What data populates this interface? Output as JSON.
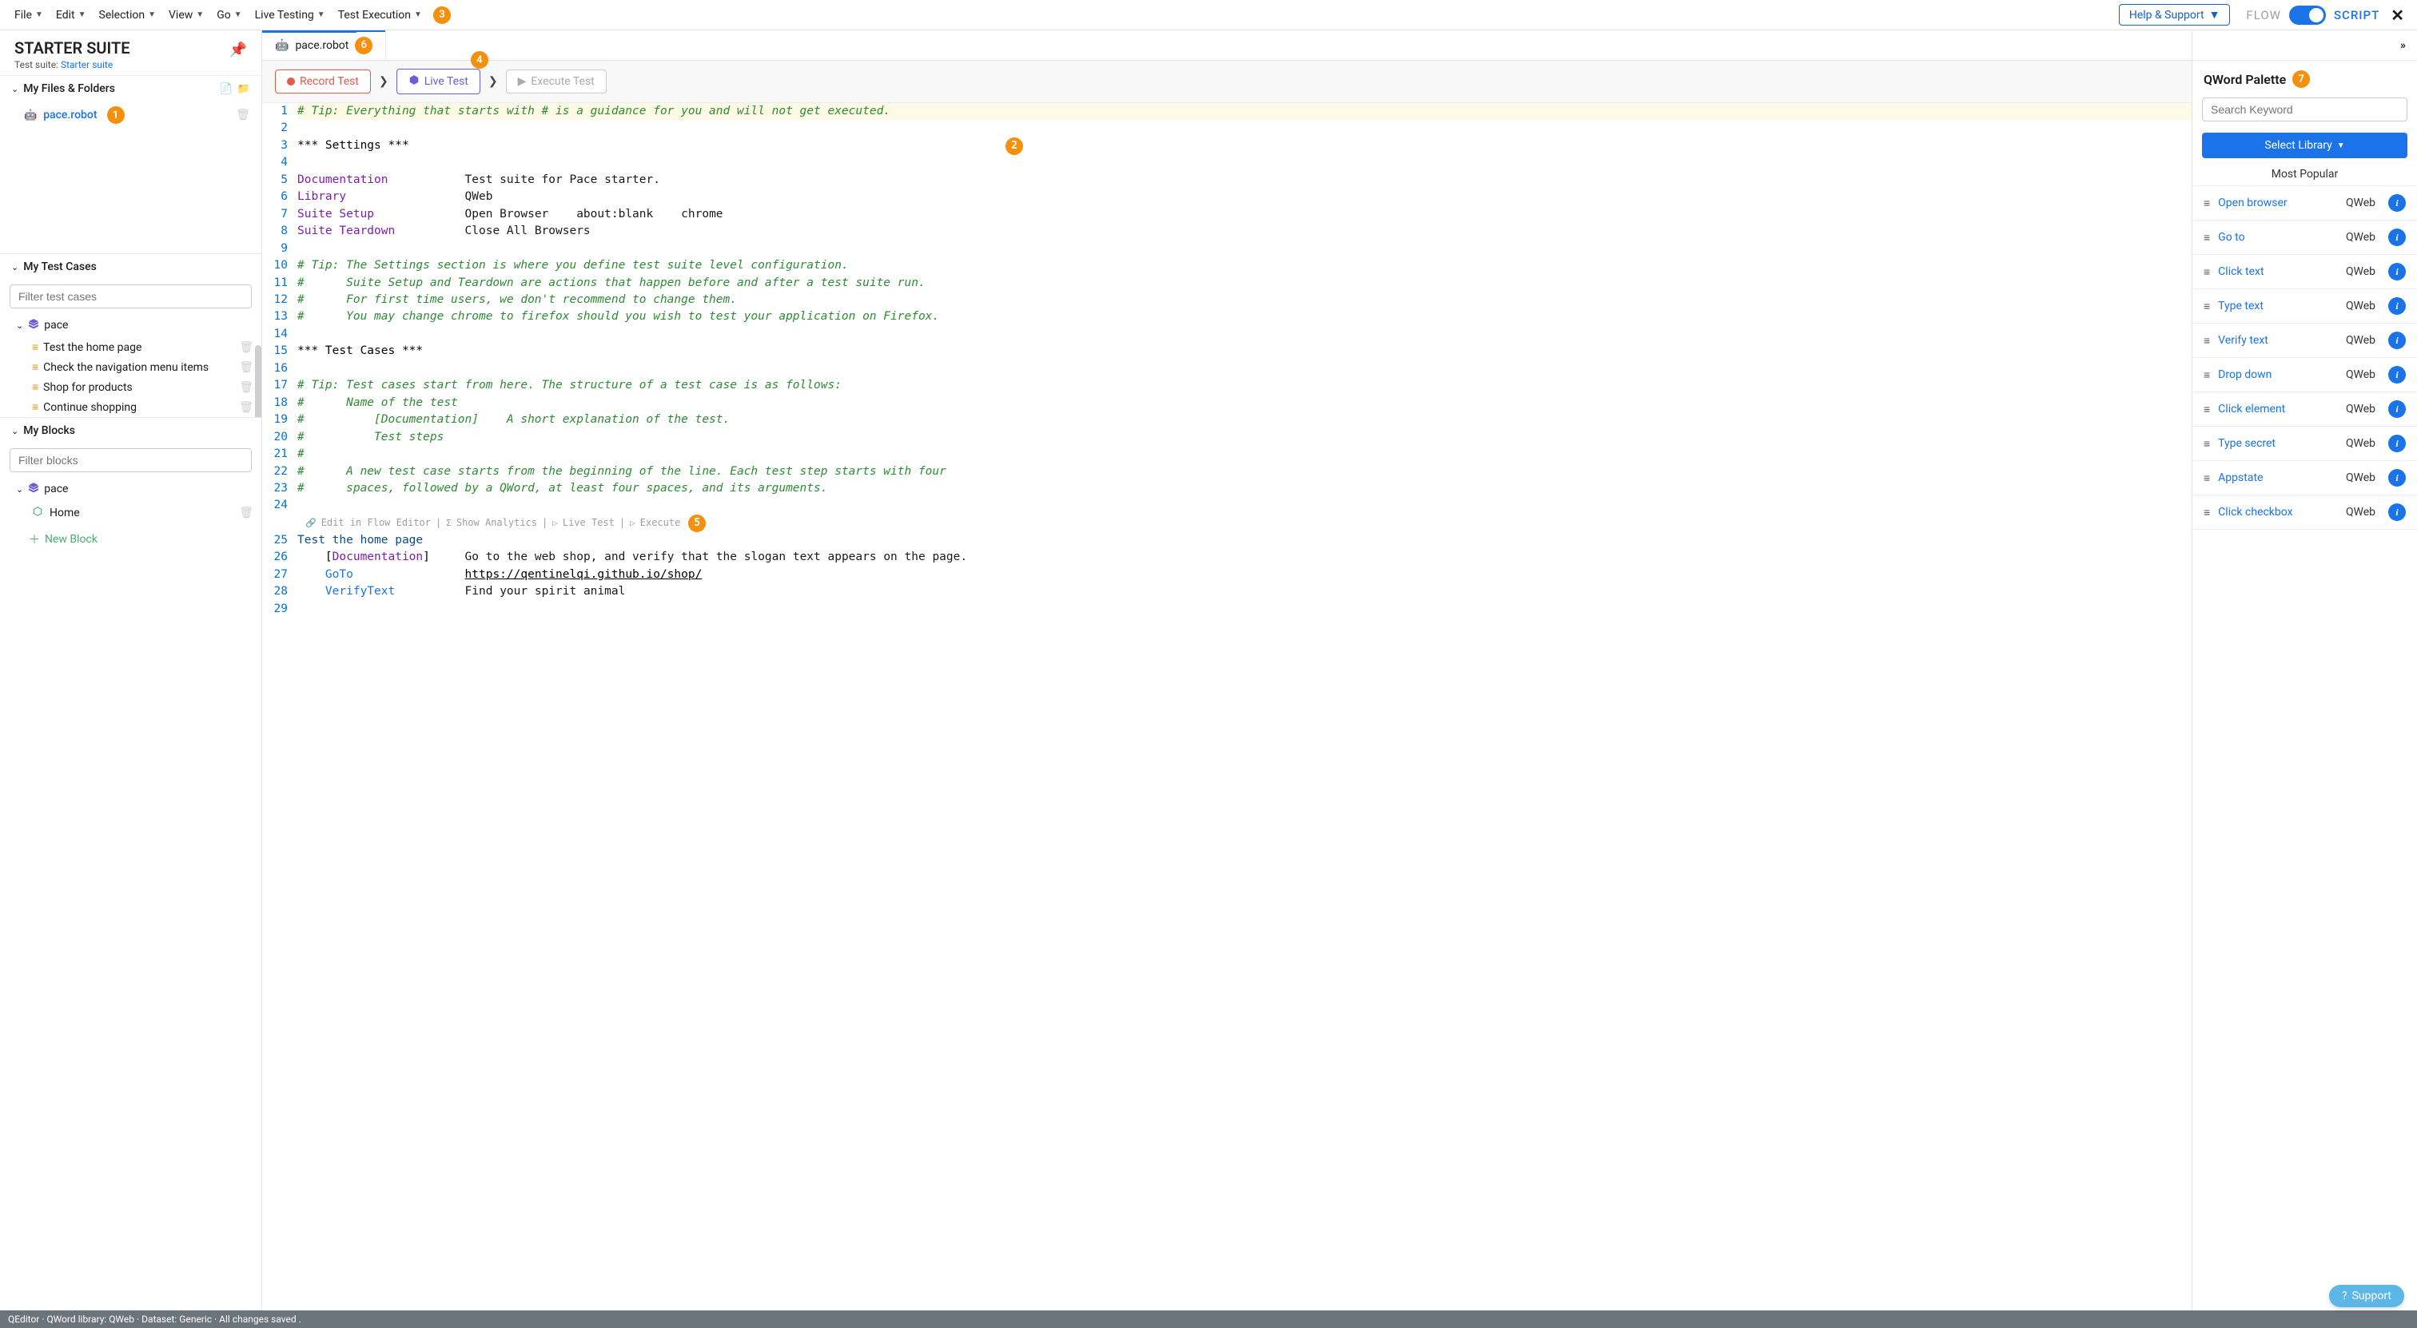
{
  "menu": {
    "items": [
      "File",
      "Edit",
      "Selection",
      "View",
      "Go",
      "Live Testing",
      "Test Execution"
    ],
    "help": "Help & Support",
    "flow": "FLOW",
    "script": "SCRIPT"
  },
  "badges": {
    "b1": "1",
    "b2": "2",
    "b3": "3",
    "b4": "4",
    "b5": "5",
    "b6": "6",
    "b7": "7"
  },
  "suite": {
    "title": "STARTER SUITE",
    "sub_label": "Test suite: ",
    "sub_link": "Starter suite"
  },
  "files": {
    "hdr": "My Files & Folders",
    "file1": "pace.robot"
  },
  "testcases": {
    "hdr": "My Test Cases",
    "filter_ph": "Filter test cases",
    "group": "pace",
    "items": [
      "Test the home page",
      "Check the navigation menu items",
      "Shop for products",
      "Continue shopping"
    ]
  },
  "blocks": {
    "hdr": "My Blocks",
    "filter_ph": "Filter blocks",
    "group": "pace",
    "home": "Home",
    "new": "New Block"
  },
  "tab": {
    "name": "pace.robot"
  },
  "actions": {
    "record": "Record Test",
    "live": "Live Test",
    "exec": "Execute Test"
  },
  "code": {
    "l1": "# Tip: Everything that starts with # is a guidance for you and will not get executed.",
    "l3": "*** Settings ***",
    "l5_k": "Documentation",
    "l5_v": "Test suite for Pace starter.",
    "l6_k": "Library",
    "l6_v": "QWeb",
    "l7_k": "Suite Setup",
    "l7_v": "Open Browser    about:blank    chrome",
    "l8_k": "Suite Teardown",
    "l8_v": "Close All Browsers",
    "l10": "# Tip: The Settings section is where you define test suite level configuration.",
    "l11": "#      Suite Setup and Teardown are actions that happen before and after a test suite run.",
    "l12": "#      For first time users, we don't recommend to change them.",
    "l13": "#      You may change chrome to firefox should you wish to test your application on Firefox.",
    "l15": "*** Test Cases ***",
    "l17": "# Tip: Test cases start from here. The structure of a test case is as follows:",
    "l18": "#      Name of the test",
    "l19": "#          [Documentation]    A short explanation of the test.",
    "l20": "#          Test steps",
    "l21": "#",
    "l22": "#      A new test case starts from the beginning of the line. Each test step starts with four",
    "l23": "#      spaces, followed by a QWord, at least four spaces, and its arguments.",
    "lens_edit": "Edit in Flow Editor",
    "lens_analytics": "Show Analytics",
    "lens_live": "Live Test",
    "lens_exec": "Execute",
    "l25": "Test the home page",
    "l26_k": "Documentation",
    "l26_v": "Go to the web shop, and verify that the slogan text appears on the page.",
    "l27_k": "GoTo",
    "l27_v": "https://qentinelqi.github.io/shop/",
    "l28_k": "VerifyText",
    "l28_v": "Find your spirit animal"
  },
  "palette": {
    "title": "QWord Palette",
    "search_ph": "Search Keyword",
    "select_lib": "Select Library",
    "most_popular": "Most Popular",
    "lib": "QWeb",
    "kws": [
      "Open browser",
      "Go to",
      "Click text",
      "Type text",
      "Verify text",
      "Drop down",
      "Click element",
      "Type secret",
      "Appstate",
      "Click checkbox"
    ]
  },
  "status": "QEditor · QWord library: QWeb · Dataset: Generic · All changes saved .",
  "support": "Support"
}
